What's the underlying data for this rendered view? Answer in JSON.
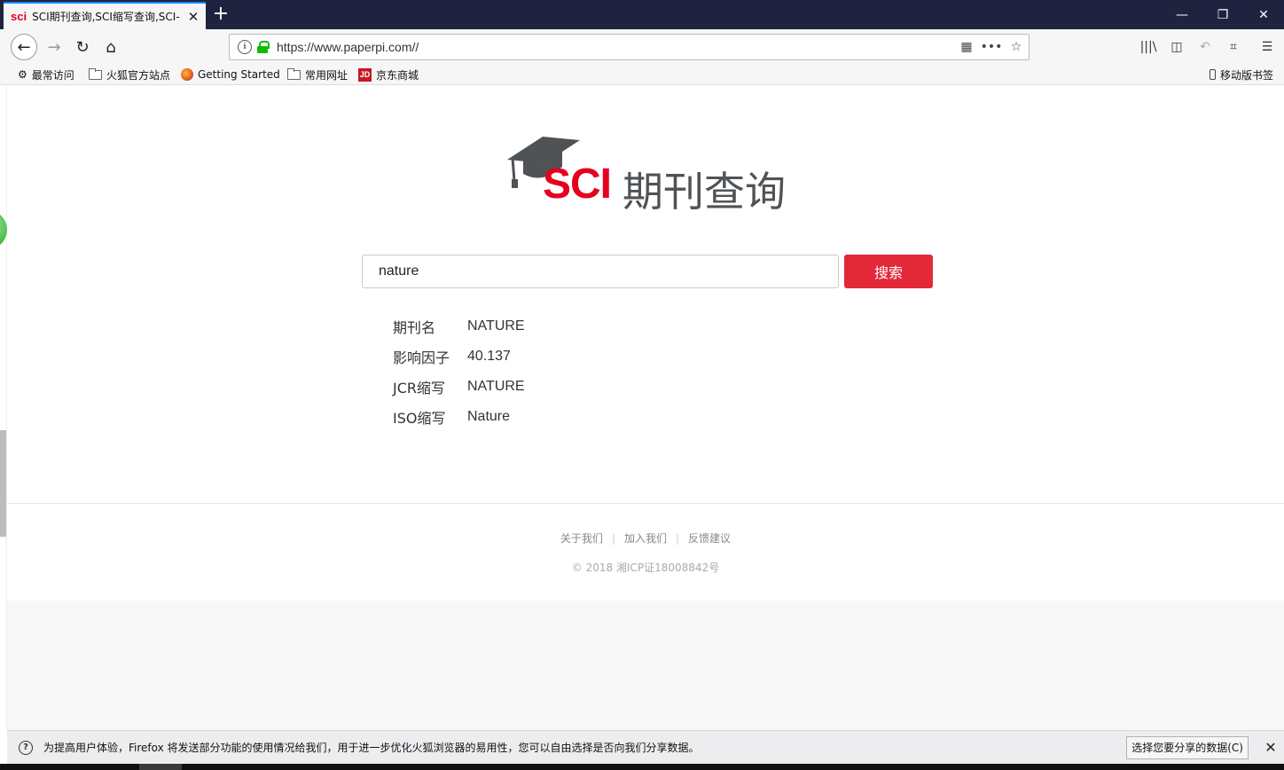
{
  "browser": {
    "tab": {
      "favicon": "sci",
      "title": "SCI期刊查询,SCI缩写查询,SCI-"
    },
    "window_controls": {
      "minimize": "🗕",
      "restore": "🗗",
      "close": "✕"
    },
    "url": "https://www.paperpi.com//",
    "bookmarks": [
      {
        "label": "最常访问",
        "icon": "gear-icon"
      },
      {
        "label": "火狐官方站点",
        "icon": "folder-icon"
      },
      {
        "label": "Getting Started",
        "icon": "firefox-icon"
      },
      {
        "label": "常用网址",
        "icon": "folder-icon"
      },
      {
        "label": "京东商城",
        "icon": "jd-icon",
        "icon_text": "JD"
      }
    ],
    "mobile_bookmarks": "移动版书签"
  },
  "page": {
    "logo": {
      "brand": "SCI",
      "name": "期刊查询"
    },
    "search": {
      "value": "nature",
      "button": "搜索"
    },
    "results": [
      {
        "label": "期刊名",
        "value": "NATURE"
      },
      {
        "label": "影响因子",
        "value": "40.137"
      },
      {
        "label": "JCR缩写",
        "value": "NATURE"
      },
      {
        "label": "ISO缩写",
        "value": "Nature"
      }
    ],
    "footer": {
      "links": [
        "关于我们",
        "加入我们",
        "反馈建议"
      ],
      "copyright": "© 2018 湘ICP证18008842号"
    }
  },
  "notification": {
    "text": "为提高用户体验，Firefox 将发送部分功能的使用情况给我们，用于进一步优化火狐浏览器的易用性，您可以自由选择是否向我们分享数据。",
    "button": "选择您要分享的数据(C)",
    "close": "✕"
  },
  "colors": {
    "brand_red": "#e6001e",
    "button_red": "#e32838",
    "tab_accent": "#0a84ff",
    "titlebar": "#202340"
  }
}
